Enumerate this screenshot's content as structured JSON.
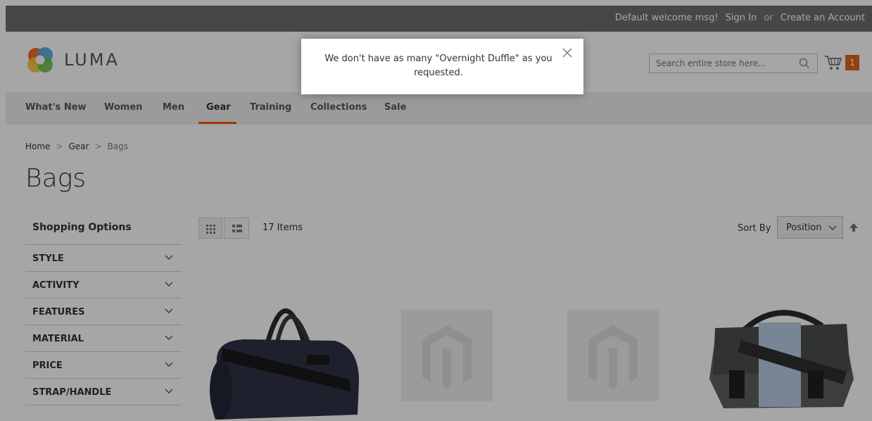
{
  "topbar": {
    "welcome": "Default welcome msg!",
    "sign_in": "Sign In",
    "or": "or",
    "create_account": "Create an Account"
  },
  "header": {
    "logo_text": "LUMA",
    "search_placeholder": "Search entire store here...",
    "cart_count": "1",
    "accent_color": "#e0641e"
  },
  "nav": {
    "items": [
      "What's New",
      "Women",
      "Men",
      "Gear",
      "Training",
      "Collections",
      "Sale"
    ],
    "active": "Gear"
  },
  "breadcrumb": {
    "items": [
      "Home",
      "Gear",
      "Bags"
    ]
  },
  "page_title": "Bags",
  "sidebar": {
    "title": "Shopping Options",
    "filters": [
      "STYLE",
      "ACTIVITY",
      "FEATURES",
      "MATERIAL",
      "PRICE",
      "STRAP/HANDLE"
    ]
  },
  "toolbar": {
    "amount": "17 Items",
    "sort_label": "Sort By",
    "sort_value": "Position"
  },
  "modal": {
    "message": "We don't have as many \"Overnight Duffle\" as you requested."
  },
  "icons": {
    "close": "close-icon",
    "search": "search-icon",
    "cart": "cart-icon",
    "chevron": "chevron-down-icon",
    "sort": "sort-arrow-up-icon"
  }
}
